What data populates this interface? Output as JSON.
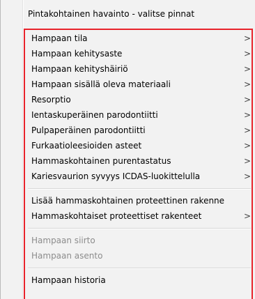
{
  "menu": {
    "header": "Pintakohtainen havainto - valitse pinnat",
    "group1": [
      {
        "label": "Hampaan tila",
        "arrow": ">"
      },
      {
        "label": "Hampaan kehitysaste",
        "arrow": ">"
      },
      {
        "label": "Hampaan kehityshäiriö",
        "arrow": ">"
      },
      {
        "label": "Hampaan sisällä oleva materiaali",
        "arrow": ">"
      },
      {
        "label": "Resorptio",
        "arrow": ">"
      },
      {
        "label": "Ientaskuperäinen parodontiitti",
        "arrow": ">"
      },
      {
        "label": "Pulpaperäinen parodontiitti",
        "arrow": ">"
      },
      {
        "label": "Furkaatioleesioiden asteet",
        "arrow": ">"
      },
      {
        "label": "Hammaskohtainen purentastatus",
        "arrow": ">"
      },
      {
        "label": "Kariesvaurion syvyys ICDAS-luokittelulla",
        "arrow": ">"
      }
    ],
    "group2": [
      {
        "label": "Lisää hammaskohtainen proteettinen rakenne",
        "arrow": ""
      },
      {
        "label": "Hammaskohtaiset proteettiset rakenteet",
        "arrow": ">"
      }
    ],
    "group3": [
      {
        "label": "Hampaan siirto"
      },
      {
        "label": "Hampaan asento"
      }
    ],
    "group4": [
      {
        "label": "Hampaan historia"
      }
    ],
    "highlight_color": "#e8232b"
  }
}
